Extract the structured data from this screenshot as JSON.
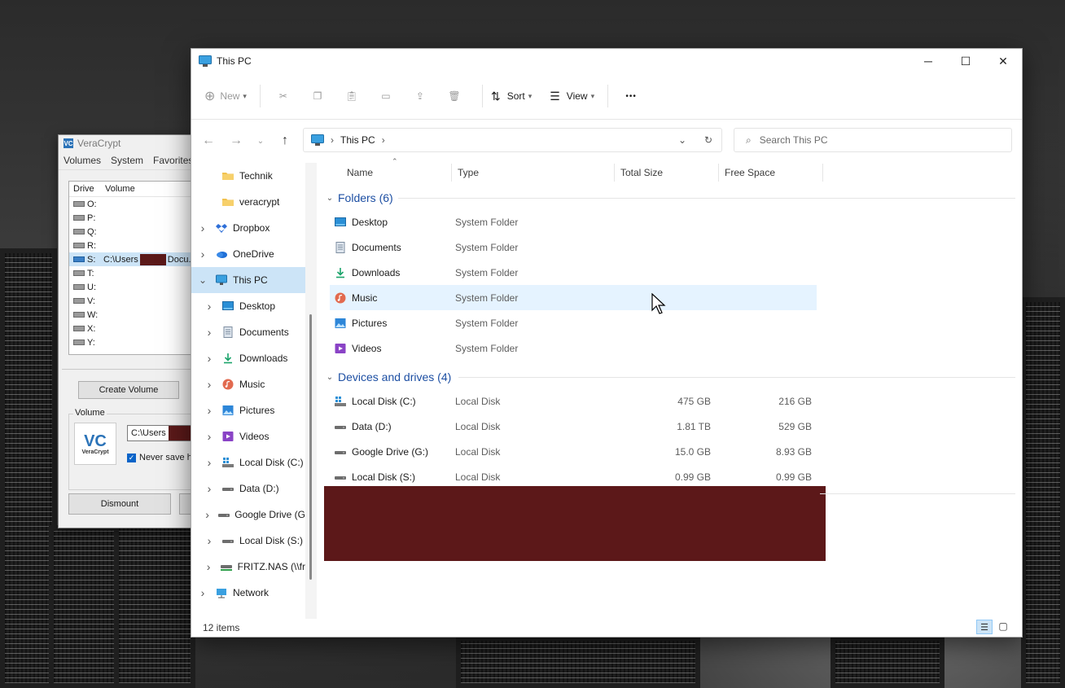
{
  "veracrypt": {
    "title": "VeraCrypt",
    "logo_glyph": "VC",
    "menu": [
      "Volumes",
      "System",
      "Favorites"
    ],
    "columns": {
      "drive": "Drive",
      "volume": "Volume"
    },
    "drives": [
      {
        "letter": "O:",
        "path": ""
      },
      {
        "letter": "P:",
        "path": ""
      },
      {
        "letter": "Q:",
        "path": ""
      },
      {
        "letter": "R:",
        "path": ""
      },
      {
        "letter": "S:",
        "path_prefix": "C:\\Users",
        "path_suffix": "Docu...",
        "selected": true
      },
      {
        "letter": "T:",
        "path": ""
      },
      {
        "letter": "U:",
        "path": ""
      },
      {
        "letter": "V:",
        "path": ""
      },
      {
        "letter": "W:",
        "path": ""
      },
      {
        "letter": "X:",
        "path": ""
      },
      {
        "letter": "Y:",
        "path": ""
      }
    ],
    "create_volume": "Create Volume",
    "volume_label": "Volume",
    "logo_text": "VeraCrypt",
    "volume_path": "C:\\Users",
    "never_save": "Never save h",
    "dismount": "Dismount"
  },
  "explorer": {
    "title": "This PC",
    "toolbar": {
      "new": "New",
      "sort": "Sort",
      "view": "View",
      "more": "•••"
    },
    "address": {
      "location": "This PC"
    },
    "search_placeholder": "Search This PC",
    "tree": [
      {
        "label": "Technik",
        "icon": "folder",
        "indent": 1,
        "expandable": false
      },
      {
        "label": "veracrypt",
        "icon": "folder",
        "indent": 1,
        "expandable": false
      },
      {
        "label": "Dropbox",
        "icon": "dropbox",
        "indent": 0,
        "expandable": true
      },
      {
        "label": "OneDrive",
        "icon": "onedrive",
        "indent": 0,
        "expandable": true
      },
      {
        "label": "This PC",
        "icon": "pc",
        "indent": 0,
        "expandable": true,
        "expanded": true,
        "selected": true
      },
      {
        "label": "Desktop",
        "icon": "desktop",
        "indent": 1,
        "expandable": true
      },
      {
        "label": "Documents",
        "icon": "documents",
        "indent": 1,
        "expandable": true
      },
      {
        "label": "Downloads",
        "icon": "downloads",
        "indent": 1,
        "expandable": true
      },
      {
        "label": "Music",
        "icon": "music",
        "indent": 1,
        "expandable": true
      },
      {
        "label": "Pictures",
        "icon": "pictures",
        "indent": 1,
        "expandable": true
      },
      {
        "label": "Videos",
        "icon": "videos",
        "indent": 1,
        "expandable": true
      },
      {
        "label": "Local Disk (C:)",
        "icon": "windisk",
        "indent": 1,
        "expandable": true
      },
      {
        "label": "Data (D:)",
        "icon": "disk",
        "indent": 1,
        "expandable": true
      },
      {
        "label": "Google Drive (G",
        "icon": "disk",
        "indent": 1,
        "expandable": true
      },
      {
        "label": "Local Disk (S:)",
        "icon": "disk",
        "indent": 1,
        "expandable": true
      },
      {
        "label": "FRITZ.NAS (\\\\fr",
        "icon": "netdrive",
        "indent": 1,
        "expandable": true
      },
      {
        "label": "Network",
        "icon": "network",
        "indent": 0,
        "expandable": true
      }
    ],
    "columns": {
      "name": "Name",
      "type": "Type",
      "total": "Total Size",
      "free": "Free Space"
    },
    "groups": [
      {
        "label": "Folders (6)",
        "items": [
          {
            "name": "Desktop",
            "type": "System Folder",
            "icon": "desktop"
          },
          {
            "name": "Documents",
            "type": "System Folder",
            "icon": "documents"
          },
          {
            "name": "Downloads",
            "type": "System Folder",
            "icon": "downloads"
          },
          {
            "name": "Music",
            "type": "System Folder",
            "icon": "music",
            "hover": true
          },
          {
            "name": "Pictures",
            "type": "System Folder",
            "icon": "pictures"
          },
          {
            "name": "Videos",
            "type": "System Folder",
            "icon": "videos"
          }
        ]
      },
      {
        "label": "Devices and drives (4)",
        "items": [
          {
            "name": "Local Disk (C:)",
            "type": "Local Disk",
            "total": "475 GB",
            "free": "216 GB",
            "icon": "windisk"
          },
          {
            "name": "Data (D:)",
            "type": "Local Disk",
            "total": "1.81 TB",
            "free": "529 GB",
            "icon": "disk"
          },
          {
            "name": "Google Drive (G:)",
            "type": "Local Disk",
            "total": "15.0 GB",
            "free": "8.93 GB",
            "icon": "disk"
          },
          {
            "name": "Local Disk (S:)",
            "type": "Local Disk",
            "total": "0.99 GB",
            "free": "0.99 GB",
            "icon": "disk"
          }
        ]
      }
    ],
    "status": "12 items",
    "colors": {
      "accent": "#1d4fa3",
      "selection": "#cce4f7",
      "hover": "#e5f3ff",
      "redaction": "#5c1819"
    }
  }
}
